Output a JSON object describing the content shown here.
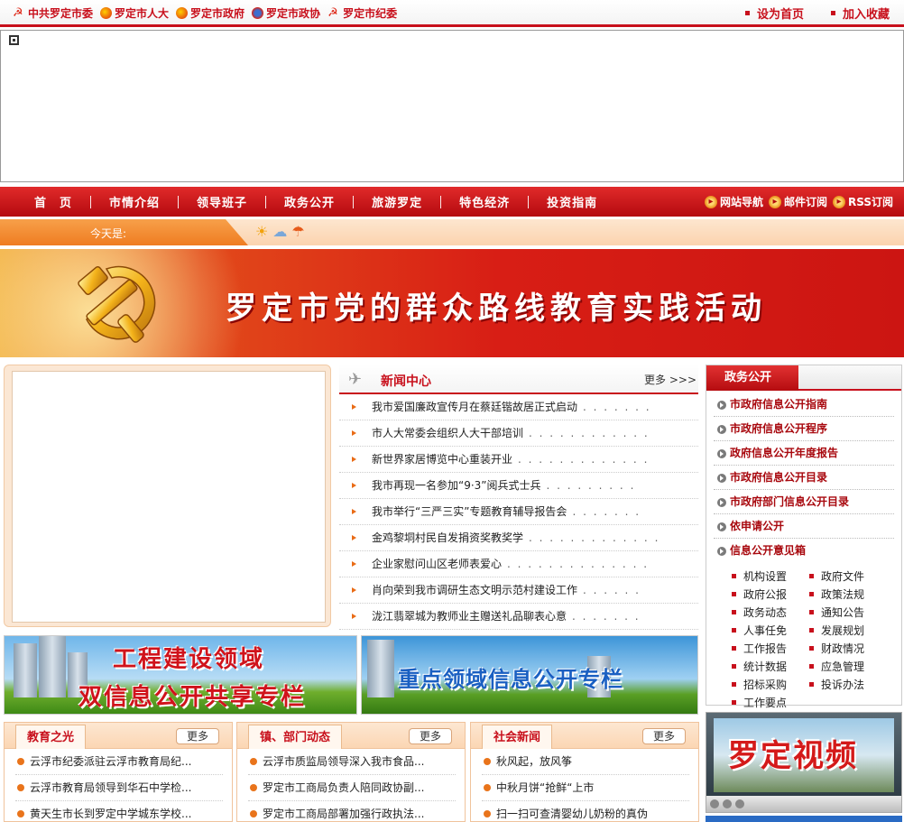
{
  "top_links": [
    {
      "label": "中共罗定市委",
      "icon": "party-emblem-icon"
    },
    {
      "label": "罗定市人大",
      "icon": "national-emblem-icon"
    },
    {
      "label": "罗定市政府",
      "icon": "national-emblem-icon"
    },
    {
      "label": "罗定市政协",
      "icon": "cppcc-emblem-icon"
    },
    {
      "label": "罗定市纪委",
      "icon": "party-emblem-icon"
    }
  ],
  "utility_links": {
    "set_home": "设为首页",
    "bookmark": "加入收藏"
  },
  "nav": {
    "items": [
      "首　页",
      "市情介绍",
      "领导班子",
      "政务公开",
      "旅游罗定",
      "特色经济",
      "投资指南"
    ],
    "extras": [
      "网站导航",
      "邮件订阅",
      "RSS订阅"
    ]
  },
  "date_bar": {
    "label": "今天是:"
  },
  "banner": {
    "title": "罗定市党的群众路线教育实践活动"
  },
  "news_center": {
    "title": "新闻中心",
    "more": "更多 >>>",
    "items": [
      "我市爱国廉政宣传月在蔡廷锴故居正式启动",
      "市人大常委会组织人大干部培训",
      "新世界家居博览中心重装开业",
      "我市再现一名参加“9·3”阅兵式士兵",
      "我市举行“三严三实”专题教育辅导报告会",
      "金鸡黎垌村民自发捐资奖教奖学",
      "企业家慰问山区老师表爱心",
      "肖向荣到我市调研生态文明示范村建设工作",
      "泷江翡翠城为教师业主赠送礼品聊表心意"
    ]
  },
  "gov_affairs": {
    "title": "政务公开",
    "guide_links": [
      "市政府信息公开指南",
      "市政府信息公开程序",
      "政府信息公开年度报告",
      "市政府信息公开目录",
      "市政府部门信息公开目录",
      "依申请公开",
      "信息公开意见箱"
    ],
    "categories": [
      "机构设置",
      "政府文件",
      "政府公报",
      "政策法规",
      "政务动态",
      "通知公告",
      "人事任免",
      "发展规划",
      "工作报告",
      "财政情况",
      "统计数据",
      "应急管理",
      "招标采购",
      "投诉办法",
      "工作要点"
    ]
  },
  "promo": {
    "left_line1": "工程建设领域",
    "left_line2": "双信息公开共享专栏",
    "right": "重点领域信息公开专栏"
  },
  "panels": [
    {
      "title": "教育之光",
      "more": "更多",
      "items": [
        "云浮市纪委派驻云浮市教育局纪...",
        "云浮市教育局领导到华石中学检...",
        "黄天生市长到罗定中学城东学校..."
      ]
    },
    {
      "title": "镇、部门动态",
      "more": "更多",
      "items": [
        "云浮市质监局领导深入我市食品...",
        "罗定市工商局负责人陪同政协副...",
        "罗定市工商局部署加强行政执法..."
      ]
    },
    {
      "title": "社会新闻",
      "more": "更多",
      "items": [
        "秋风起，放风筝",
        "中秋月饼“抢鲜“上市",
        "扫一扫可查清婴幼儿奶粉的真伪"
      ]
    }
  ],
  "video": {
    "title": "罗定视频"
  },
  "colors": {
    "brand_red": "#c8101c",
    "orange": "#ef7c21",
    "panel_border": "#f0c39c"
  }
}
